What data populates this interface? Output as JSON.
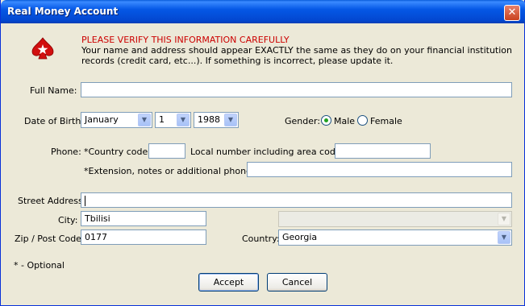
{
  "window": {
    "title": "Real Money Account",
    "close_label": "✕"
  },
  "notice": {
    "heading": "PLEASE VERIFY THIS INFORMATION CAREFULLY",
    "line1": "Your name and address should appear EXACTLY the same as they do on your financial institution",
    "line2": "records (credit card, etc...). If something is incorrect, please update it."
  },
  "labels": {
    "full_name": "Full Name:",
    "dob": "Date of Birth:",
    "gender": "Gender:",
    "male": "Male",
    "female": "Female",
    "phone": "Phone:",
    "country_code": "*Country code:",
    "local_number": "Local number including area code:",
    "extension": "*Extension, notes or additional phone:",
    "street": "Street Address:",
    "city": "City:",
    "zip": "Zip / Post Code:",
    "country": "Country:",
    "optional_note": "* - Optional"
  },
  "fields": {
    "full_name": "",
    "dob_month": "January",
    "dob_day": "1",
    "dob_year": "1988",
    "gender_selected": "Male",
    "country_code": "",
    "local_number": "",
    "extension": "",
    "street": "",
    "city": "Tbilisi",
    "state": "",
    "zip": "0177",
    "country": "Georgia"
  },
  "buttons": {
    "accept": "Accept",
    "cancel": "Cancel"
  },
  "icons": {
    "logo": "spade-star-icon",
    "dropdown": "chevron-down-icon"
  },
  "colors": {
    "title_bar": "#0558e6",
    "window_bg": "#ece9d8",
    "warning": "#cc0000"
  }
}
